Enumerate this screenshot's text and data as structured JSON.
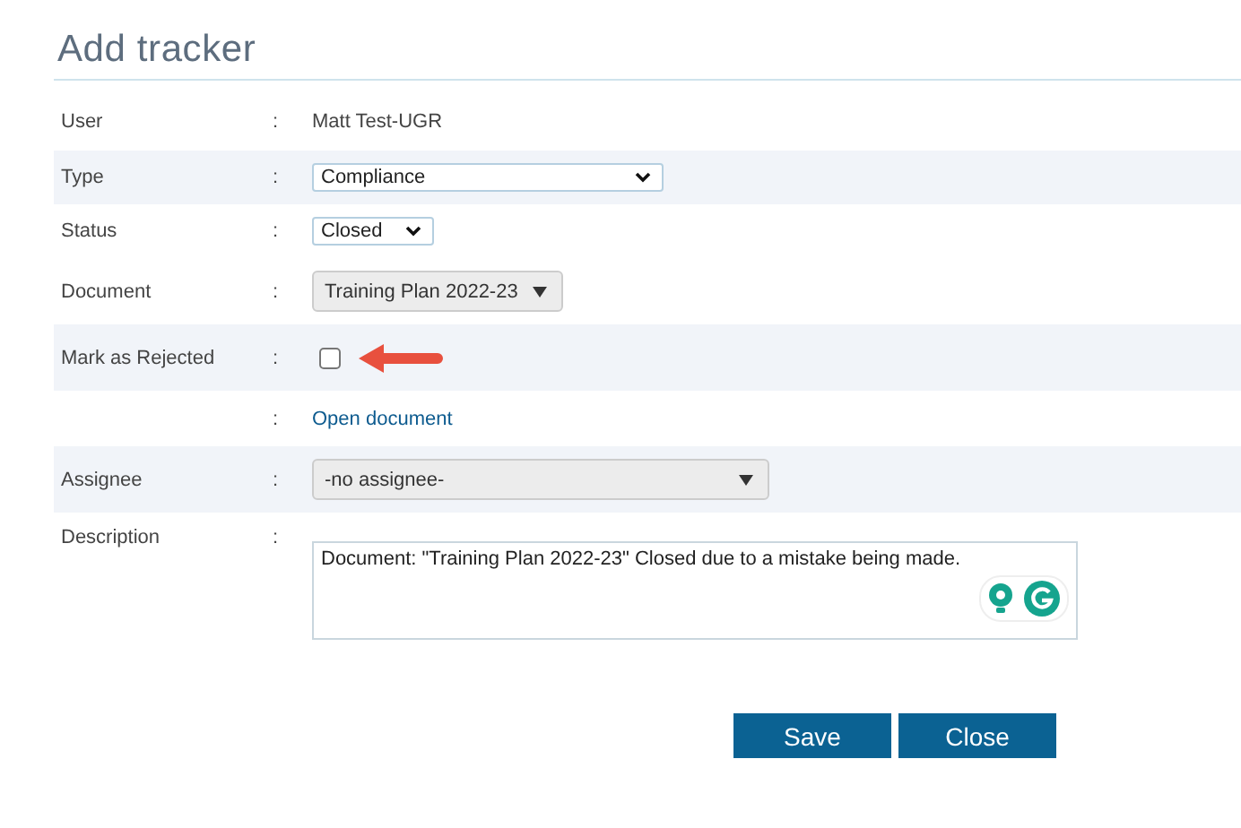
{
  "title": "Add tracker",
  "rows": [
    {
      "kind": "text",
      "label": "User",
      "colon": ":",
      "value": "Matt Test-UGR",
      "shaded": false
    },
    {
      "kind": "select",
      "label": "Type",
      "colon": ":",
      "value": "Compliance",
      "shaded": true
    },
    {
      "kind": "select",
      "label": "Status",
      "colon": ":",
      "value": "Closed",
      "shaded": false
    },
    {
      "kind": "dropdown",
      "label": "Document",
      "colon": ":",
      "value": "Training Plan 2022-23",
      "shaded": false
    },
    {
      "kind": "checkbox",
      "label": "Mark as Rejected",
      "colon": ":",
      "checked": false,
      "shaded": true,
      "annotated": true
    },
    {
      "kind": "link",
      "colon": ":",
      "value": "Open document",
      "shaded": false
    },
    {
      "kind": "dropdown",
      "label": "Assignee",
      "colon": ":",
      "value": "-no assignee-",
      "shaded": true
    },
    {
      "kind": "textarea",
      "label": "Description",
      "colon": ":",
      "value": "Document: \"Training Plan 2022-23\" Closed due to a mistake being made.",
      "shaded": false
    }
  ],
  "buttons": [
    "Save",
    "Close"
  ]
}
